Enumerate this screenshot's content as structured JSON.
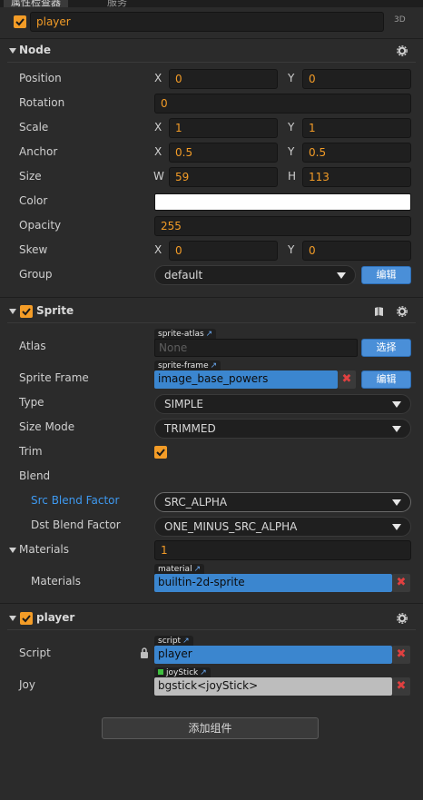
{
  "tabs": [
    "属性检查器",
    "服务"
  ],
  "node_name": "player",
  "badge_3d": "3D",
  "node_section": {
    "title": "Node",
    "position": {
      "label": "Position",
      "x_axis": "X",
      "x": "0",
      "y_axis": "Y",
      "y": "0"
    },
    "rotation": {
      "label": "Rotation",
      "value": "0"
    },
    "scale": {
      "label": "Scale",
      "x_axis": "X",
      "x": "1",
      "y_axis": "Y",
      "y": "1"
    },
    "anchor": {
      "label": "Anchor",
      "x_axis": "X",
      "x": "0.5",
      "y_axis": "Y",
      "y": "0.5"
    },
    "size": {
      "label": "Size",
      "w_axis": "W",
      "w": "59",
      "h_axis": "H",
      "h": "113"
    },
    "color": {
      "label": "Color",
      "value_hex": "#ffffff"
    },
    "opacity": {
      "label": "Opacity",
      "value": "255"
    },
    "skew": {
      "label": "Skew",
      "x_axis": "X",
      "x": "0",
      "y_axis": "Y",
      "y": "0"
    },
    "group": {
      "label": "Group",
      "value": "default",
      "edit_button": "编辑"
    }
  },
  "sprite_section": {
    "title": "Sprite",
    "atlas": {
      "label": "Atlas",
      "tag": "sprite-atlas",
      "value": "None",
      "select_button": "选择"
    },
    "sprite_frame": {
      "label": "Sprite Frame",
      "tag": "sprite-frame",
      "value": "image_base_powers",
      "edit_button": "编辑"
    },
    "type": {
      "label": "Type",
      "value": "SIMPLE"
    },
    "size_mode": {
      "label": "Size Mode",
      "value": "TRIMMED"
    },
    "trim": {
      "label": "Trim",
      "checked": true
    },
    "blend": {
      "label": "Blend"
    },
    "src_blend": {
      "label": "Src Blend Factor",
      "value": "SRC_ALPHA"
    },
    "dst_blend": {
      "label": "Dst Blend Factor",
      "value": "ONE_MINUS_SRC_ALPHA"
    },
    "materials_count": {
      "label": "Materials",
      "value": "1"
    },
    "materials": {
      "label": "Materials",
      "tag": "material",
      "value": "builtin-2d-sprite"
    }
  },
  "player_section": {
    "title": "player",
    "script": {
      "label": "Script",
      "tag": "script",
      "value": "player"
    },
    "joy": {
      "label": "Joy",
      "tag": "joyStick",
      "value": "bgstick<joyStick>"
    }
  },
  "add_component_button": "添加组件",
  "colors": {
    "accent_orange": "#f39c27",
    "blue_button": "#4a8fd8",
    "blue_field": "#3b86cf",
    "panel_bg": "#2b2b2b",
    "label_blue": "#3e99f0"
  }
}
